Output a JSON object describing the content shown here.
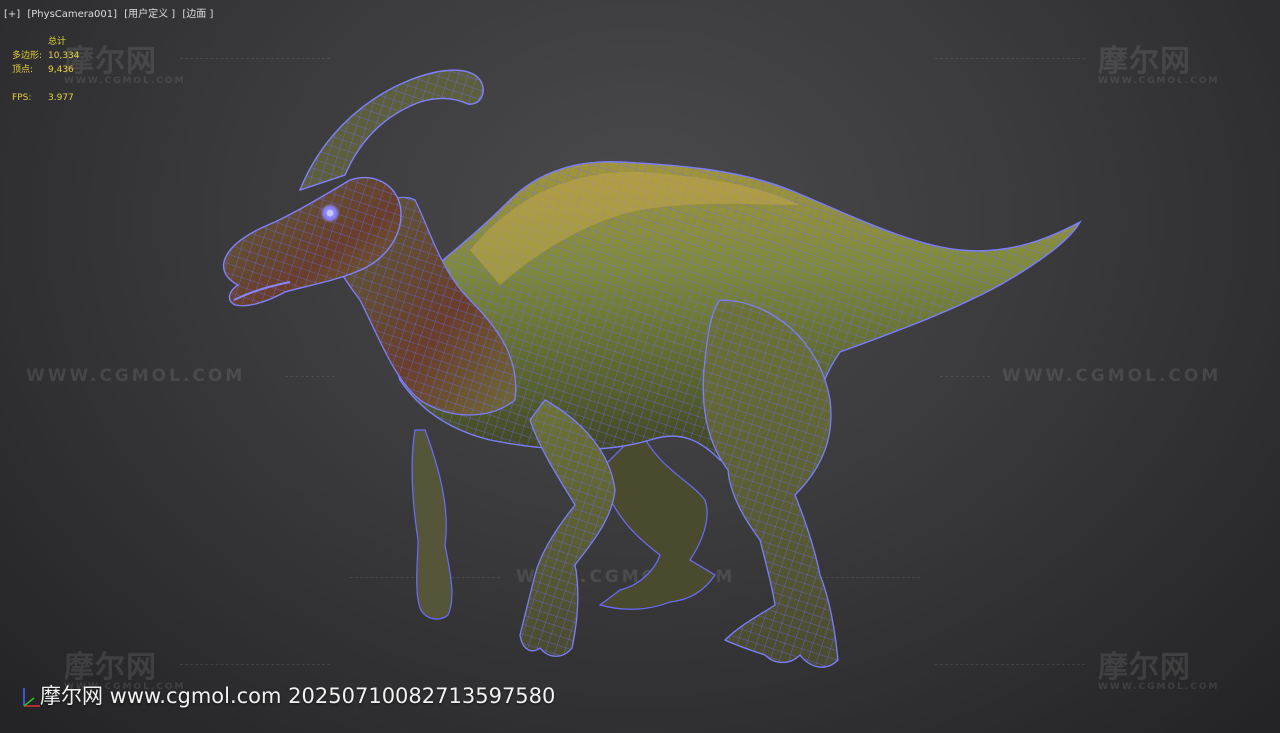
{
  "viewport": {
    "label_plus": "[+]",
    "label_camera": "[PhysCamera001]",
    "label_view": "[用户定义 ]",
    "label_shading": "[边面 ]"
  },
  "stats": {
    "header": "总计",
    "polys_label": "多边形:",
    "polys_value": "10,334",
    "verts_label": "顶点:",
    "verts_value": "9,436",
    "fps_label": "FPS:",
    "fps_value": "3.977"
  },
  "watermarks": {
    "logo": "摩尔网",
    "sub": "WWW.CGMOL.COM",
    "url": "WWW.CGMOL.COM"
  },
  "bottom_watermark": "摩尔网 www.cgmol.com 20250710082713597580",
  "colors": {
    "wire": "#6a6cff",
    "skin_green": "#7f8a3a",
    "stats_text": "#e6d23a"
  }
}
